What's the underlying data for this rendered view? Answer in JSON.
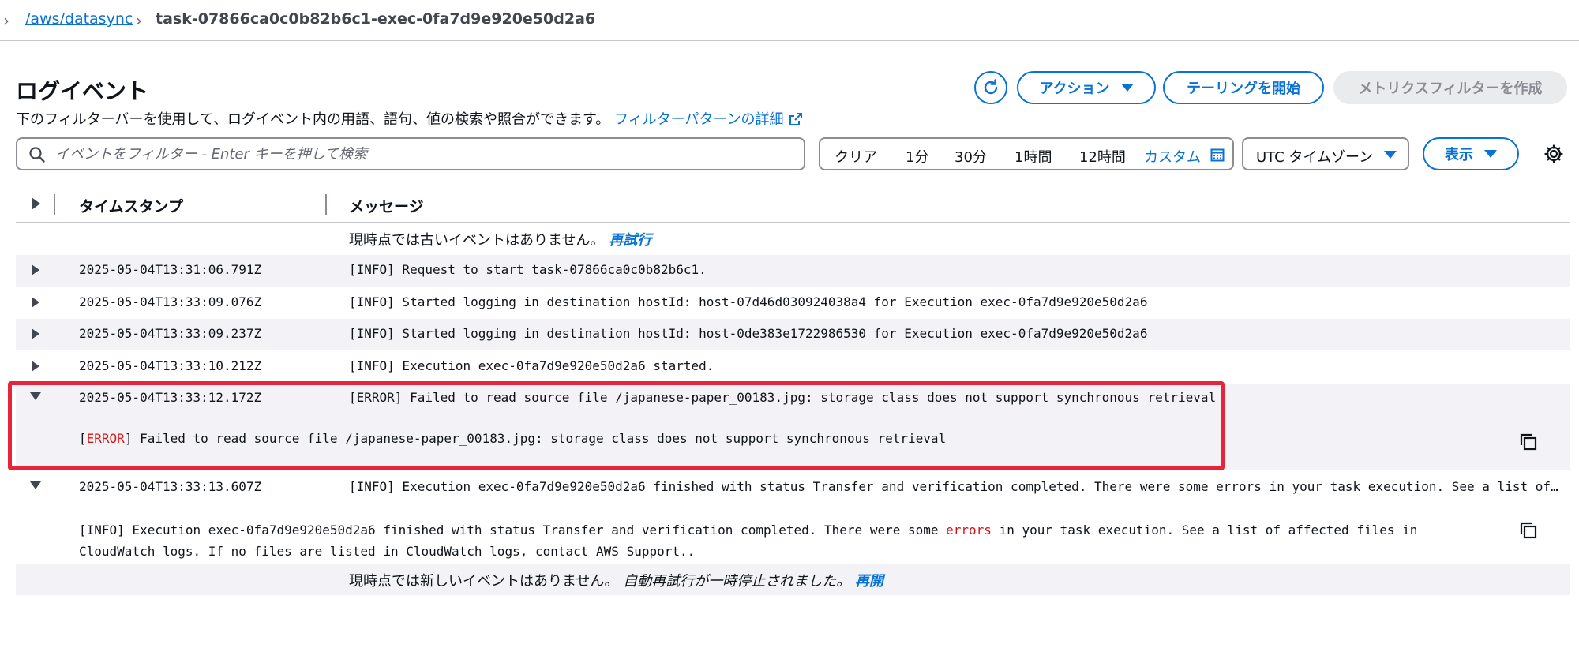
{
  "breadcrumb": {
    "parent": "/aws/datasync",
    "current": "task-07866ca0c0b82b6c1-exec-0fa7d9e920e50d2a6"
  },
  "header": {
    "title": "ログイベント",
    "description": "下のフィルターバーを使用して、ログイベント内の用語、語句、値の検索や照合ができます。",
    "filter_link": "フィルターパターンの詳細"
  },
  "actions": {
    "action_label": "アクション",
    "tail_label": "テーリングを開始",
    "metric_filter_label": "メトリクスフィルターを作成"
  },
  "search": {
    "placeholder": "イベントをフィルター - Enter キーを押して検索",
    "value": ""
  },
  "time_range": {
    "items": [
      "クリア",
      "1分",
      "30分",
      "1時間",
      "12時間",
      "カスタム"
    ],
    "selected": "カスタム"
  },
  "timezone": {
    "label": "UTC タイムゾーン"
  },
  "display": {
    "label": "表示"
  },
  "table": {
    "col_timestamp": "タイムスタンプ",
    "col_message": "メッセージ"
  },
  "notices": {
    "top_text": "現時点では古いイベントはありません。",
    "top_link": "再試行",
    "bottom_text": "現時点では新しいイベントはありません。",
    "bottom_paused": "自動再試行が一時停止されました。",
    "bottom_link": "再開"
  },
  "rows": [
    {
      "timestamp": "2025-05-04T13:31:06.791Z",
      "message": "[INFO] Request to start task-07866ca0c0b82b6c1."
    },
    {
      "timestamp": "2025-05-04T13:33:09.076Z",
      "message": "[INFO] Started logging in destination hostId: host-07d46d030924038a4 for Execution exec-0fa7d9e920e50d2a6"
    },
    {
      "timestamp": "2025-05-04T13:33:09.237Z",
      "message": "[INFO] Started logging in destination hostId: host-0de383e1722986530 for Execution exec-0fa7d9e920e50d2a6"
    },
    {
      "timestamp": "2025-05-04T13:33:10.212Z",
      "message": "[INFO] Execution exec-0fa7d9e920e50d2a6 started."
    },
    {
      "timestamp": "2025-05-04T13:33:12.172Z",
      "message": "[ERROR] Failed to read source file /japanese-paper_00183.jpg: storage class does not support synchronous retrieval"
    },
    {
      "timestamp": "2025-05-04T13:33:13.607Z",
      "message": "[INFO] Execution exec-0fa7d9e920e50d2a6 finished with status Transfer and verification completed. There were some errors in your task execution. See a list of …"
    }
  ],
  "expanded_error": {
    "bracket_open": "[",
    "level": "ERROR",
    "bracket_close": "]",
    "text": " Failed to read source file /japanese-paper_00183.jpg: storage class does not support synchronous retrieval"
  },
  "expanded_info": {
    "before": "[INFO] Execution exec-0fa7d9e920e50d2a6 finished with status Transfer and verification completed. There were some ",
    "highlight": "errors",
    "after": " in your task execution. See a list of affected files in CloudWatch logs. If no files are listed in CloudWatch logs, contact AWS Support.."
  },
  "colors": {
    "link": "#0972d3",
    "error": "#d91515",
    "highlight_box": "#e8243c",
    "row_alt": "#f3f3f7"
  }
}
